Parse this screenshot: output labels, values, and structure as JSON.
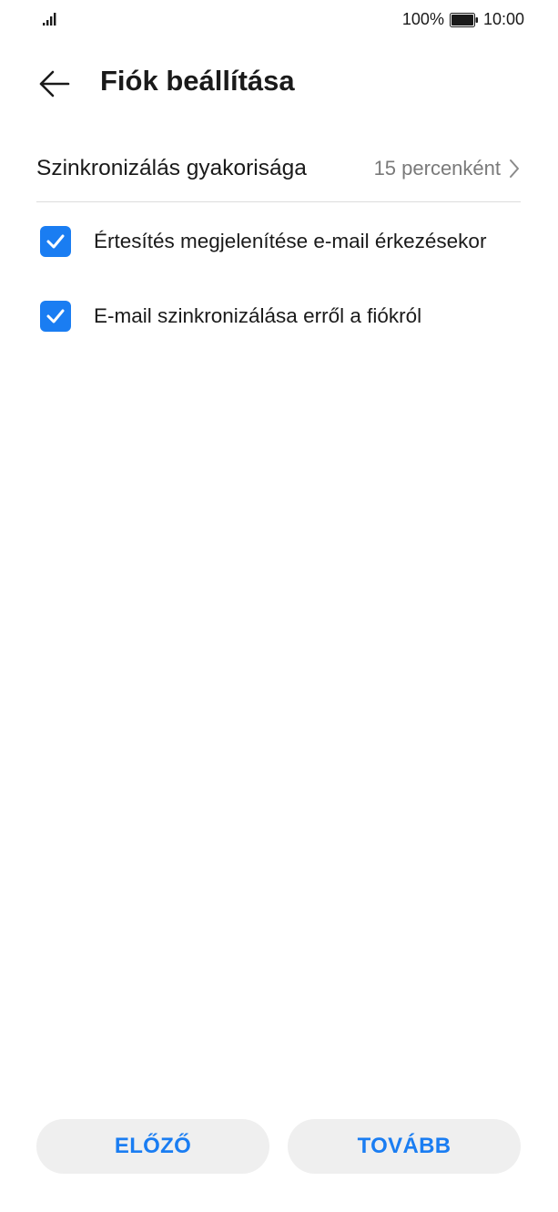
{
  "status_bar": {
    "battery_percent": "100%",
    "time": "10:00",
    "battery_level": 1.0,
    "icons": [
      "signal-icon",
      "battery-icon"
    ]
  },
  "header": {
    "title": "Fiók beállítása",
    "back_icon": "arrow-left-icon"
  },
  "sync_frequency": {
    "label": "Szinkronizálás gyakorisága",
    "value": "15 percenként",
    "icon": "chevron-right-icon"
  },
  "options": [
    {
      "label": "Értesítés megjelenítése e-mail érkezésekor",
      "checked": true
    },
    {
      "label": "E-mail szinkronizálása erről a fiókról",
      "checked": true
    }
  ],
  "buttons": {
    "prev_label": "ELŐZŐ",
    "next_label": "TOVÁBB"
  },
  "colors": {
    "accent": "#1a7df2",
    "button_bg": "#efefef",
    "text": "#1a1a1a",
    "secondary_text": "#7a7a7a",
    "divider": "#dcdcdc"
  }
}
